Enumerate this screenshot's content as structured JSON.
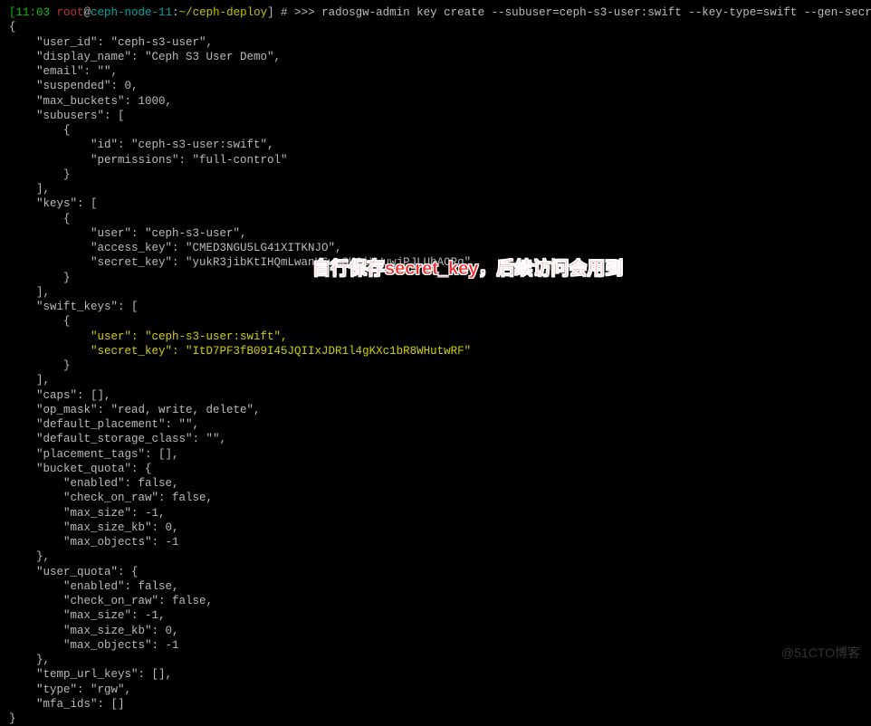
{
  "prompt": {
    "time": "[11:03 ",
    "user": "root",
    "at": "@",
    "host": "ceph-node-11",
    "colon": ":",
    "path": "~/ceph-deploy",
    "close_bracket": "]",
    "symbol": " # >>> ",
    "command": "radosgw-admin key create --subuser=ceph-s3-user:swift --key-type=swift --gen-secret"
  },
  "json_top": "{\n    \"user_id\": \"ceph-s3-user\",\n    \"display_name\": \"Ceph S3 User Demo\",\n    \"email\": \"\",\n    \"suspended\": 0,\n    \"max_buckets\": 1000,\n    \"subusers\": [\n        {\n            \"id\": \"ceph-s3-user:swift\",\n            \"permissions\": \"full-control\"\n        }\n    ],\n    \"keys\": [\n        {\n            \"user\": \"ceph-s3-user\",\n            \"access_key\": \"CMED3NGU5LG41XITKNJO\",\n            \"secret_key\": \"yukR3jibKtIHQmLwanK6wsSUCiXWuwjPJLUhAORq\"\n        }\n    ],\n    \"swift_keys\": [\n        {",
  "hl_line1": "            \"user\": \"ceph-s3-user:swift\",",
  "hl_line2": "            \"secret_key\": \"ItD7PF3fB09I45JQIIxJDR1l4gKXc1bR8WHutwRF\"",
  "json_bottom": "        }\n    ],\n    \"caps\": [],\n    \"op_mask\": \"read, write, delete\",\n    \"default_placement\": \"\",\n    \"default_storage_class\": \"\",\n    \"placement_tags\": [],\n    \"bucket_quota\": {\n        \"enabled\": false,\n        \"check_on_raw\": false,\n        \"max_size\": -1,\n        \"max_size_kb\": 0,\n        \"max_objects\": -1\n    },\n    \"user_quota\": {\n        \"enabled\": false,\n        \"check_on_raw\": false,\n        \"max_size\": -1,\n        \"max_size_kb\": 0,\n        \"max_objects\": -1\n    },\n    \"temp_url_keys\": [],\n    \"type\": \"rgw\",\n    \"mfa_ids\": []\n}",
  "annotation_text": "自行保存secret_key，后续访问会用到",
  "watermark_text": "@51CTO博客"
}
